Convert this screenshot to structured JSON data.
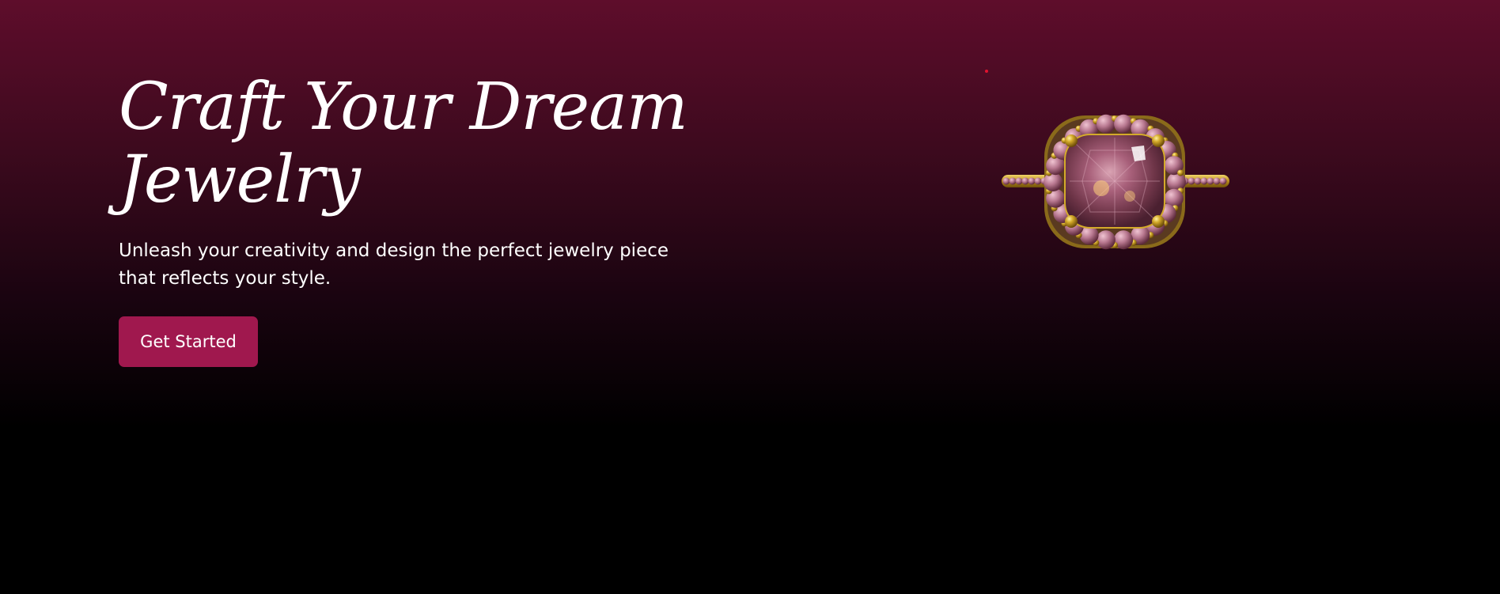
{
  "hero": {
    "title_line1": "Craft Your Dream",
    "title_line2": "Jewelry",
    "subtitle": "Unleash your creativity and design the perfect jewelry piece that reflects your style.",
    "cta_label": "Get Started"
  },
  "colors": {
    "background_top": "#5e0d2b",
    "background_bottom": "#000000",
    "cta_background": "#a0184e",
    "text": "#ffffff",
    "ring_gold": "#c9a227",
    "ring_gem": "#8a4a5e"
  },
  "icons": {
    "ring": "ring-image"
  }
}
